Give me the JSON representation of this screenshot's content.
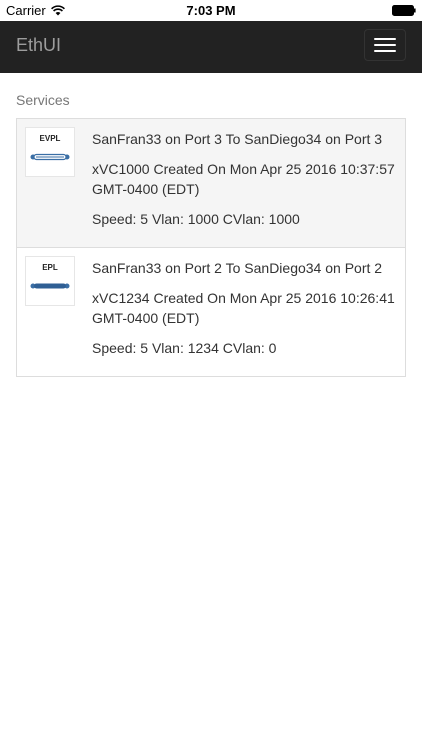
{
  "status_bar": {
    "carrier": "Carrier",
    "time": "7:03 PM"
  },
  "navbar": {
    "brand": "EthUI",
    "toggle_icon": "hamburger-menu-icon"
  },
  "section": {
    "title": "Services"
  },
  "services": [
    {
      "type_label": "EVPL",
      "title": "SanFran33 on Port 3 To SanDiego34 on Port 3",
      "created": "xVC1000 Created On Mon Apr 25 2016 10:37:57 GMT-0400 (EDT)",
      "details": "Speed: 5 Vlan: 1000 CVlan: 1000",
      "active": true
    },
    {
      "type_label": "EPL",
      "title": "SanFran33 on Port 2 To SanDiego34 on Port 2",
      "created": "xVC1234 Created On Mon Apr 25 2016 10:26:41 GMT-0400 (EDT)",
      "details": "Speed: 5 Vlan: 1234 CVlan: 0",
      "active": false
    }
  ],
  "colors": {
    "navbar_bg": "#222222",
    "brand_text": "#9d9d9d",
    "link_blue": "#3a6ea5"
  }
}
